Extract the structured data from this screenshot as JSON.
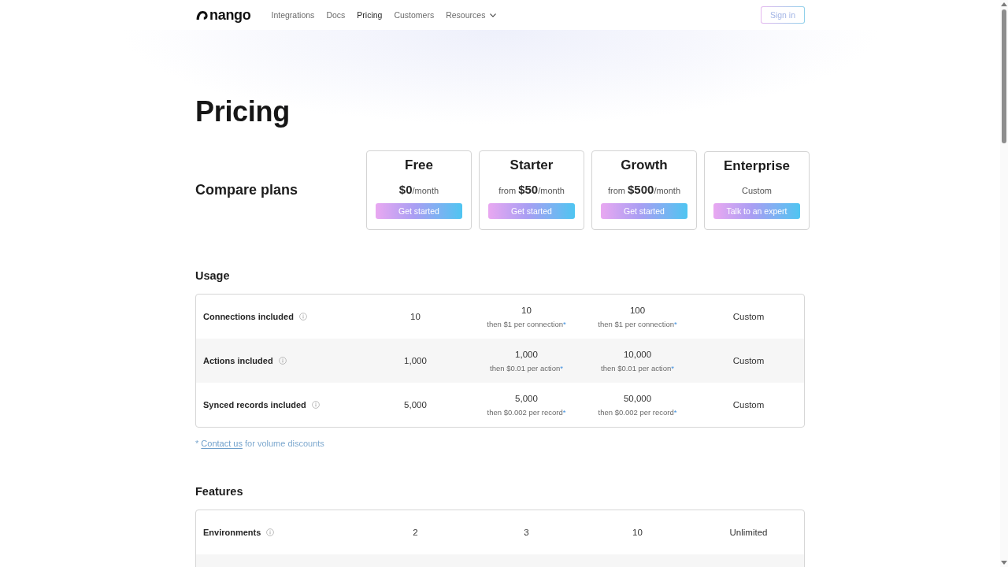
{
  "nav": {
    "logo": "nango",
    "links": [
      {
        "label": "Integrations",
        "kind": "link",
        "selected": false
      },
      {
        "label": "Docs",
        "kind": "link",
        "selected": false
      },
      {
        "label": "Pricing",
        "kind": "link",
        "selected": true
      },
      {
        "label": "Customers",
        "kind": "link",
        "selected": false
      },
      {
        "label": "Resources",
        "kind": "dropdown",
        "selected": false
      }
    ],
    "sign_in": "Sign in"
  },
  "hero": {
    "title": "Pricing"
  },
  "plans": {
    "heading": "Compare plans",
    "items": [
      {
        "name": "Free",
        "kind": "price",
        "amount": "$0",
        "period": "/month",
        "button": "Get started"
      },
      {
        "name": "Starter",
        "kind": "price",
        "prefix": "from",
        "amount": "$50",
        "period": "/month",
        "button": "Get started"
      },
      {
        "name": "Growth",
        "kind": "price",
        "prefix": "from",
        "amount": "$500",
        "period": "/month",
        "button": "Get started"
      },
      {
        "name": "Enterprise",
        "kind": "custom",
        "text": "Custom",
        "button": "Talk to an expert"
      }
    ]
  },
  "usage": {
    "heading": "Usage",
    "rows": [
      {
        "label": "Connections included",
        "cells": [
          {
            "value": "10"
          },
          {
            "value": "10",
            "note": "then $1 per connection",
            "mark": "*"
          },
          {
            "value": "100",
            "note": "then $1 per connection",
            "mark": "*"
          },
          {
            "value": "Custom"
          }
        ]
      },
      {
        "label": "Actions included",
        "cells": [
          {
            "value": "1,000"
          },
          {
            "value": "1,000",
            "note": "then $0.01 per action",
            "mark": "*"
          },
          {
            "value": "10,000",
            "note": "then $0.01 per action",
            "mark": "*"
          },
          {
            "value": "Custom"
          }
        ]
      },
      {
        "label": "Synced records included",
        "cells": [
          {
            "value": "5,000"
          },
          {
            "value": "5,000",
            "note": "then $0.002 per record",
            "mark": "*"
          },
          {
            "value": "50,000",
            "note": "then $0.002 per record",
            "mark": "*"
          },
          {
            "value": "Custom"
          }
        ]
      }
    ]
  },
  "footnote": {
    "mark": "*",
    "link": "Contact us",
    "text": "for volume discounts"
  },
  "features": {
    "heading": "Features",
    "rows": [
      {
        "label": "Environments",
        "cells": [
          {
            "value": "2"
          },
          {
            "value": "3"
          },
          {
            "value": "10"
          },
          {
            "value": "Unlimited"
          }
        ]
      }
    ]
  }
}
